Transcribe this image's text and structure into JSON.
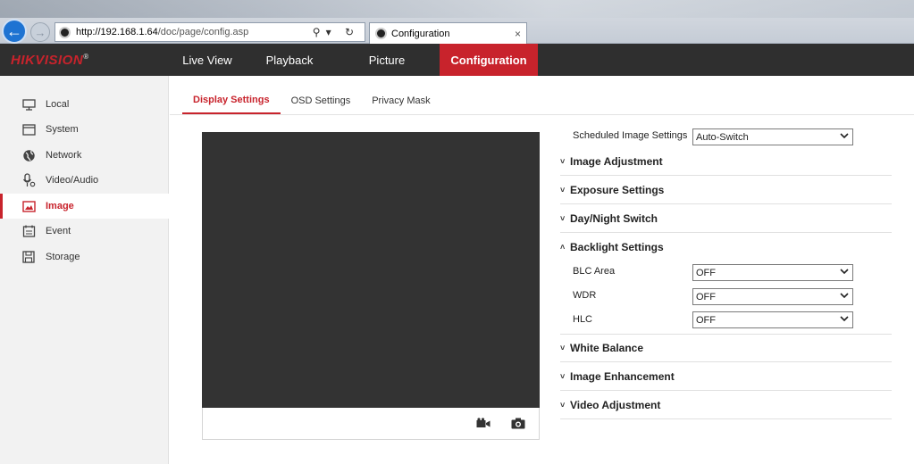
{
  "browser": {
    "url_host": "http://192.168.1.64",
    "url_path": "/doc/page/config.asp",
    "tab_title": "Configuration",
    "tab_close": "×",
    "address_icons": "⚲▾ ↻"
  },
  "app": {
    "logo_bold": "HIKVISION",
    "logo_reg": "®",
    "brand_color": "#c8232c"
  },
  "main_nav": [
    {
      "label": "Live View"
    },
    {
      "label": "Playback"
    },
    {
      "label": "Picture"
    },
    {
      "label": "Configuration",
      "active": true
    }
  ],
  "sidebar": {
    "items": [
      {
        "label": "Local",
        "icon": "monitor-icon"
      },
      {
        "label": "System",
        "icon": "window-icon"
      },
      {
        "label": "Network",
        "icon": "globe-icon"
      },
      {
        "label": "Video/Audio",
        "icon": "microphone-icon"
      },
      {
        "label": "Image",
        "icon": "image-icon",
        "active": true
      },
      {
        "label": "Event",
        "icon": "calendar-icon"
      },
      {
        "label": "Storage",
        "icon": "floppy-disk-icon"
      }
    ]
  },
  "subtabs": [
    {
      "label": "Display Settings",
      "active": true
    },
    {
      "label": "OSD Settings"
    },
    {
      "label": "Privacy Mask"
    }
  ],
  "video_toolbar": {
    "record_icon": "video-camera-icon",
    "capture_icon": "camera-icon"
  },
  "settings": {
    "scheduled_label": "Scheduled Image Settings",
    "scheduled_value": "Auto-Switch",
    "sections": {
      "image_adjustment": "Image Adjustment",
      "exposure": "Exposure Settings",
      "day_night": "Day/Night Switch",
      "backlight": "Backlight Settings",
      "white_balance": "White Balance",
      "image_enhancement": "Image Enhancement",
      "video_adjustment": "Video Adjustment"
    },
    "collapsed_toggle": "˅",
    "expanded_toggle": "˄",
    "backlight_fields": {
      "blc_label": "BLC Area",
      "blc_value": "OFF",
      "wdr_label": "WDR",
      "wdr_value": "OFF",
      "hlc_label": "HLC",
      "hlc_value": "OFF"
    }
  }
}
